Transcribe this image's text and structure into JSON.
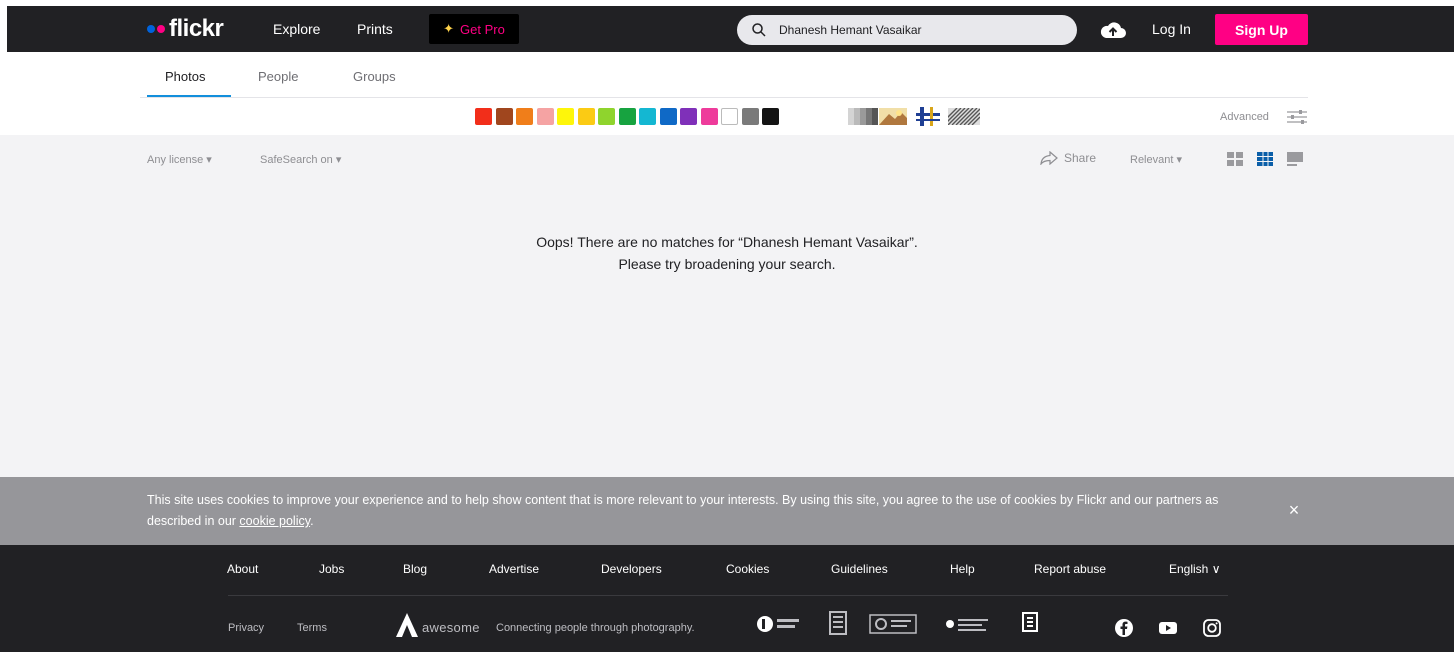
{
  "header": {
    "logo": "flickr",
    "nav": [
      "Explore",
      "Prints"
    ],
    "get_pro": "Get Pro",
    "search_value": "Dhanesh Hemant Vasaikar",
    "login": "Log In",
    "signup": "Sign Up"
  },
  "subnav": {
    "tabs": [
      "Photos",
      "People",
      "Groups"
    ],
    "active_tab": "Photos"
  },
  "colors": {
    "swatches": [
      "#f22e1a",
      "#a0461e",
      "#f07e1a",
      "#f5a3a3",
      "#fef60a",
      "#fbcb14",
      "#8fd42d",
      "#17a340",
      "#14b7d2",
      "#0f69c6",
      "#7f30b9",
      "#ee3b9b",
      "#ffffff",
      "#7a7a7a",
      "#141414"
    ],
    "advanced": "Advanced"
  },
  "filters": {
    "license": "Any license ▾",
    "safesearch": "SafeSearch on ▾",
    "share": "Share",
    "sort": "Relevant ▾"
  },
  "message": {
    "line1": "Oops! There are no matches for “Dhanesh Hemant Vasaikar”.",
    "line2": "Please try broadening your search."
  },
  "cookie": {
    "text": "This site uses cookies to improve your experience and to help show content that is more relevant to your interests. By using this site, you agree to the use of cookies by Flickr and our partners as described in our ",
    "link": "cookie policy",
    "after_link": ".",
    "close": "×"
  },
  "footer": {
    "links": [
      "About",
      "Jobs",
      "Blog",
      "Advertise",
      "Developers",
      "Cookies",
      "Guidelines",
      "Help",
      "Report abuse",
      "English ∨"
    ],
    "bottom_links": [
      "Privacy",
      "Terms"
    ],
    "awesome": "awesome",
    "tagline": "Connecting people through photography."
  },
  "theme": {
    "header_bg": "#212124",
    "accent_pink": "#ff0084",
    "accent_blue": "#128fdc",
    "cookie_bg": "#96969a"
  }
}
